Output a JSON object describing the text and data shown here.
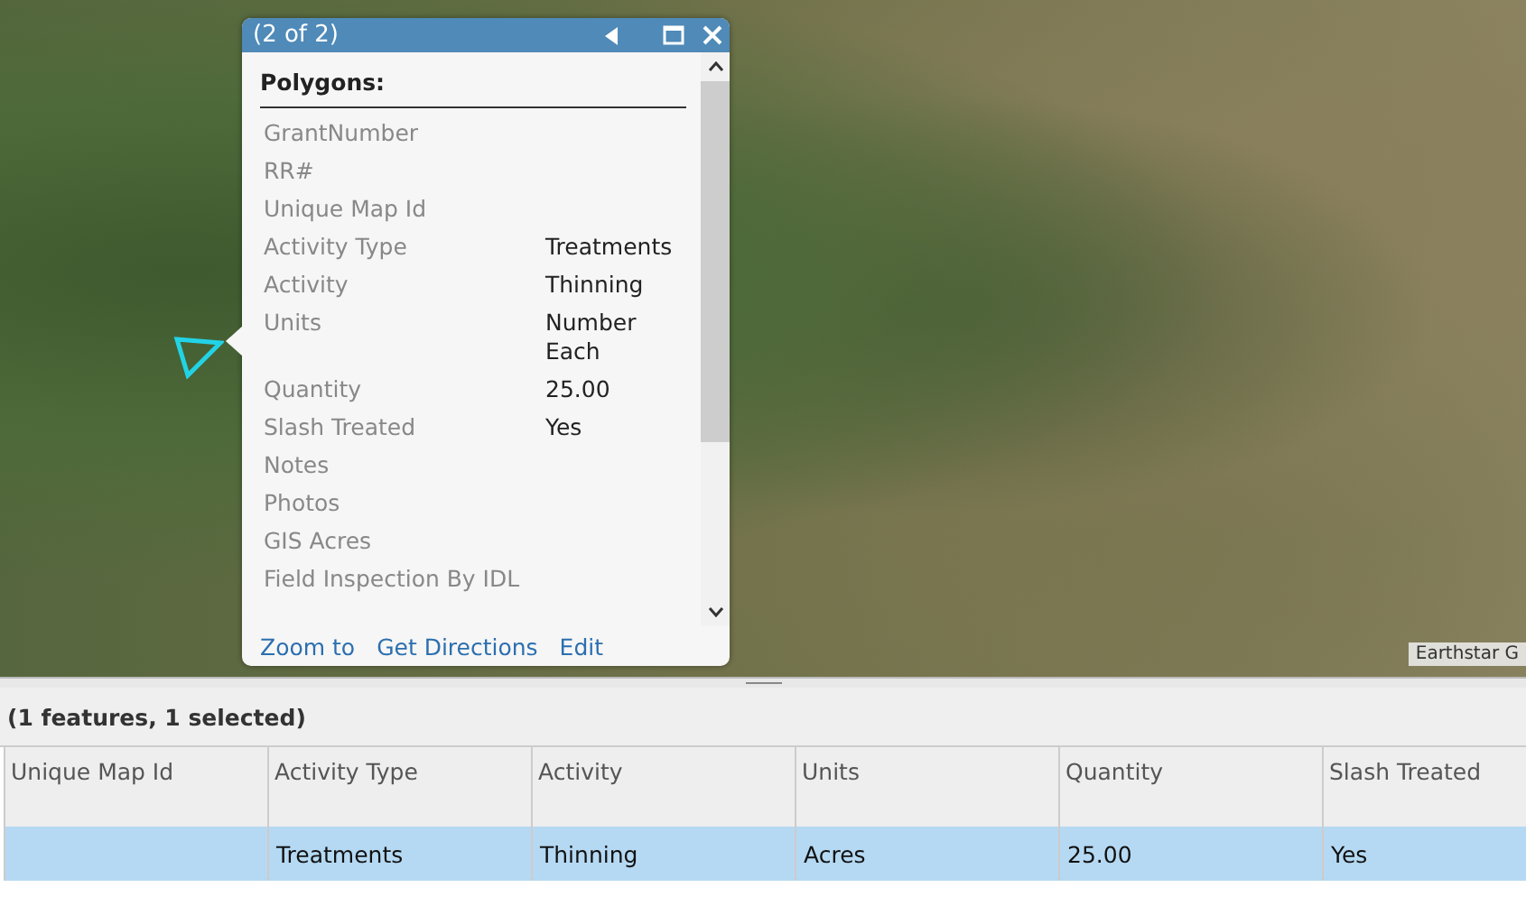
{
  "map": {
    "attribution": "Earthstar G"
  },
  "popup": {
    "title": "(2 of 2)",
    "layer": "Polygons:",
    "fields": [
      {
        "label": "GrantNumber"
      },
      {
        "label": "RR#"
      },
      {
        "label": "Unique Map Id"
      },
      {
        "label": "Activity Type",
        "value": "Treatments"
      },
      {
        "label": "Activity",
        "value": "Thinning"
      },
      {
        "label": "Units",
        "value": "Number Each"
      },
      {
        "label": "Quantity",
        "value": "25.00"
      },
      {
        "label": "Slash Treated",
        "value": "Yes"
      },
      {
        "label": "Notes"
      },
      {
        "label": "Photos"
      },
      {
        "label": "GIS Acres"
      },
      {
        "label": "Field Inspection By IDL"
      }
    ],
    "actions": [
      "Zoom to",
      "Get Directions",
      "Edit"
    ]
  },
  "table": {
    "summary": "(1 features, 1 selected)",
    "columns": [
      "Unique Map Id",
      "Activity Type",
      "Activity",
      "Units",
      "Quantity",
      "Slash Treated"
    ],
    "rows": [
      {
        "selected": true,
        "cells": [
          null,
          "Treatments",
          "Thinning",
          "Acres",
          "25.00",
          "Yes"
        ]
      }
    ]
  }
}
